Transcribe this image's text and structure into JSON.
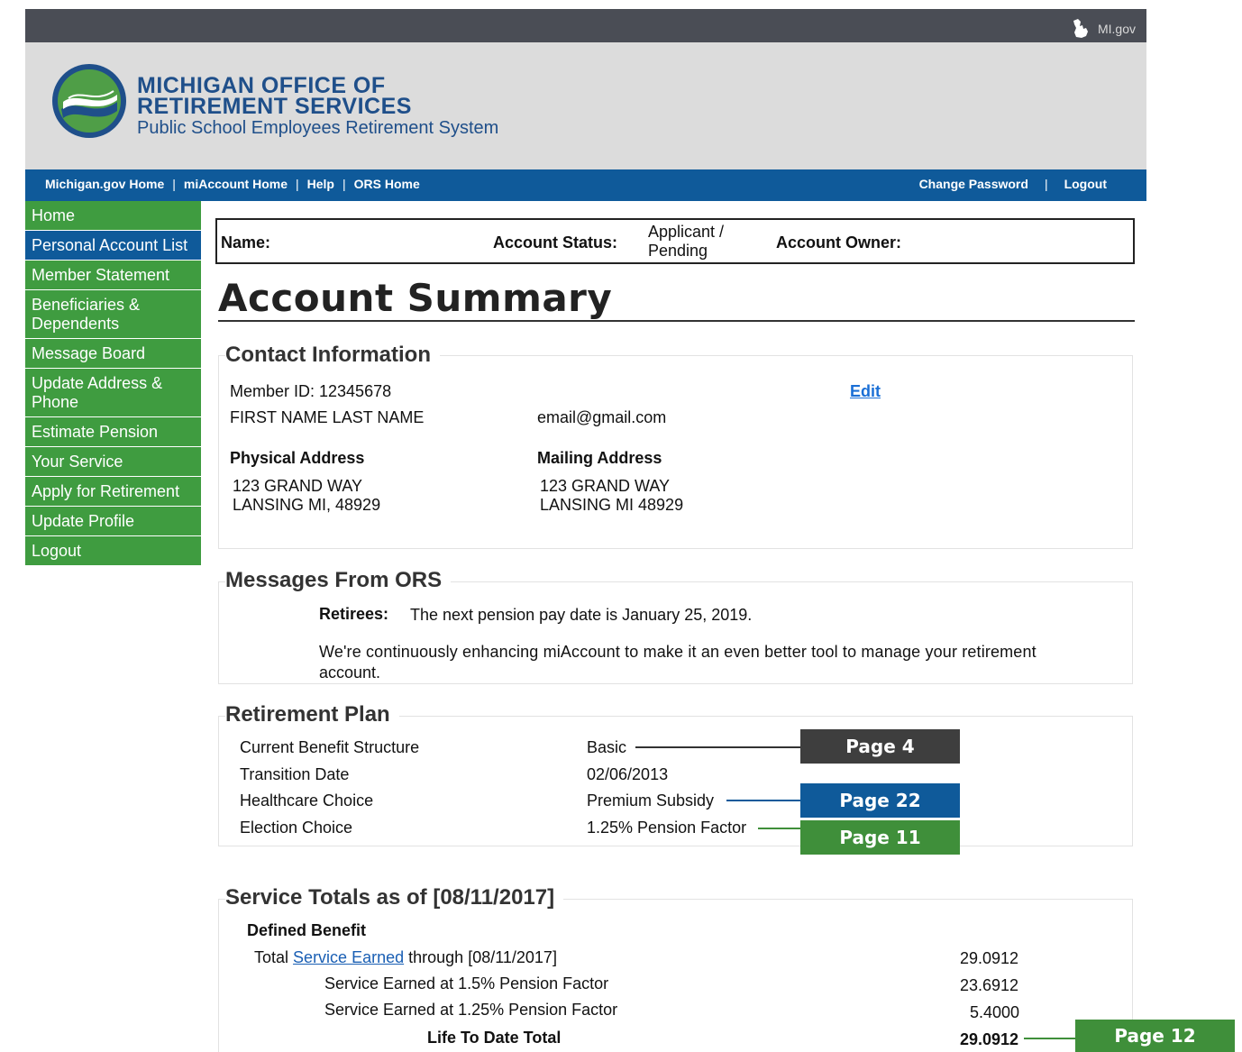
{
  "topbar": {
    "migov_label": "MI.gov"
  },
  "header": {
    "org_line1": "MICHIGAN OFFICE OF",
    "org_line2": "RETIREMENT SERVICES",
    "org_line3": "Public School Employees Retirement System"
  },
  "nav": {
    "left": [
      "Michigan.gov Home",
      "miAccount Home",
      "Help",
      "ORS Home"
    ],
    "right": [
      "Change Password",
      "Logout"
    ],
    "separator": "|"
  },
  "sidebar": {
    "items": [
      "Home",
      "Personal Account List",
      "Member Statement",
      "Beneficiaries & Dependents",
      "Message Board",
      "Update Address & Phone",
      "Estimate Pension",
      "Your Service",
      "Apply for Retirement",
      "Update Profile",
      "Logout"
    ],
    "active_index": 1
  },
  "account_bar": {
    "name_label": "Name:",
    "status_label": "Account Status:",
    "status_value": "Applicant / Pending",
    "owner_label": "Account Owner:"
  },
  "page_title": "Account Summary",
  "contact": {
    "title": "Contact Information",
    "member_id": "Member ID: 12345678",
    "name": "FIRST NAME LAST NAME",
    "email": "email@gmail.com",
    "edit_label": "Edit",
    "physical_label": "Physical Address",
    "physical_line1": "123 GRAND WAY",
    "physical_line2": "LANSING MI, 48929",
    "mailing_label": "Mailing Address",
    "mailing_line1": "123 GRAND WAY",
    "mailing_line2": "LANSING MI 48929"
  },
  "messages": {
    "title": "Messages From ORS",
    "retirees_label": "Retirees:",
    "retirees_text": "The next pension pay date is January 25, 2019.",
    "enhance_line1": "We're continuously enhancing miAccount to make it an even better tool to manage your retirement",
    "enhance_line2": "account."
  },
  "plan": {
    "title": "Retirement Plan",
    "rows": [
      {
        "label": "Current Benefit Structure",
        "value": "Basic"
      },
      {
        "label": "Transition Date",
        "value": "02/06/2013"
      },
      {
        "label": "Healthcare Choice",
        "value": "Premium Subsidy"
      },
      {
        "label": "Election Choice",
        "value": "1.25% Pension Factor"
      }
    ]
  },
  "service": {
    "title": "Service Totals as of [08/11/2017]",
    "defined_benefit": "Defined Benefit",
    "total_prefix": "Total",
    "total_link": "Service Earned",
    "total_suffix": "through [08/11/2017]",
    "total_value": "29.0912",
    "row1_label": "Service Earned at 1.5% Pension Factor",
    "row1_value": "23.6912",
    "row2_label": "Service Earned at 1.25% Pension Factor",
    "row2_value": "5.4000",
    "ltd_label": "Life To Date Total",
    "ltd_value": "29.0912"
  },
  "callouts": {
    "page4": "Page 4",
    "page22": "Page 22",
    "page11": "Page 11",
    "page12": "Page 12"
  },
  "colors": {
    "nav_blue": "#0f5a9a",
    "sidebar_green": "#3f9c40",
    "callout_dark": "#3e3e3e",
    "callout_blue": "#0f5a9a",
    "callout_green": "#3f8f3a",
    "link_blue": "#1a5fb4"
  }
}
